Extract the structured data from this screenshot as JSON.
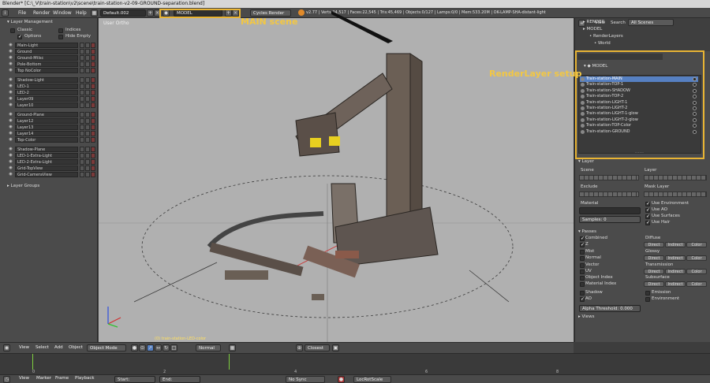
{
  "window": {
    "title": "Blender* [C:\\_V\\train-station\\v2\\scene\\train-station-v2-09-GROUND-separation.blend]"
  },
  "menubar": {
    "file": "File",
    "render": "Render",
    "window": "Window",
    "help": "Help",
    "screen_layout": "Default.002",
    "scene_name": "MODEL",
    "render_engine": "Cycles Render",
    "stats": "v2.77 | Verts:24,517 | Faces:22,545 | Tris:45,469 | Objects:0/127 | Lamps:0/0 | Mem:533.20M | OK-LAMP-SHA-distant-light"
  },
  "annotations": {
    "main_scene": "MAIN scene",
    "renderlayer_setup": "RenderLayer setup"
  },
  "left_panel": {
    "section_layer_management": "Layer Management",
    "classic": "Classic",
    "indices": "Indices",
    "options": "Options",
    "hide_empty": "Hide Empty",
    "layers_group1": [
      "Main-Light",
      "Ground",
      "Ground-Mtlsc",
      "Pole-Bottom",
      "Top NoColor"
    ],
    "layers_group2": [
      "Shadow-Light",
      "LED-1",
      "LED-2",
      "Layer09",
      "Layer10"
    ],
    "layers_group3": [
      "Ground-Plane",
      "Layer12",
      "Layer13",
      "Layer14",
      "Top-Color"
    ],
    "layers_group4": [
      "Shadow-Plane",
      "LED-1-Extra-Light",
      "LED-2-Extra-Light",
      "Grid-TopView",
      "Grid-CameraView"
    ],
    "section_layer_groups": "Layer Groups"
  },
  "viewport": {
    "label": "User Ortho",
    "bottom_label": "(0) train-station-LED-color"
  },
  "outliner": {
    "view": "View",
    "search": "Search",
    "all_scenes": "All Scenes",
    "items": [
      "RENDER",
      "MODEL",
      "RenderLayers",
      "World"
    ]
  },
  "properties": {
    "context": "MODEL",
    "renderlayers": [
      "Train-station-MAIN",
      "Train-station-TOP-1",
      "Train-station-SHADOW",
      "Train-station-TOP-2",
      "Train-station-LIGHT-1",
      "Train-station-LIGHT-2",
      "Train-station-LIGHT-1-glow",
      "Train-station-LIGHT-2-glow",
      "Train-station-TOP-Color",
      "Train-station-GROUND"
    ],
    "layer_section": "Layer",
    "scene": "Scene",
    "layer": "Layer",
    "exclude": "Exclude",
    "mask_layer": "Mask Layer",
    "material": "Material",
    "samples": "Samples:",
    "samples_value": "0",
    "use_environment": "Use Environment",
    "use_ao": "Use AO",
    "use_surfaces": "Use Surfaces",
    "use_hair": "Use Hair",
    "passes_section": "Passes",
    "combined": "Combined",
    "z": "Z",
    "mist": "Mist",
    "normal": "Normal",
    "vector": "Vector",
    "uv": "UV",
    "object_index": "Object Index",
    "material_index": "Material Index",
    "shadow": "Shadow",
    "ao": "AO",
    "diffuse": "Diffuse",
    "glossy": "Glossy",
    "transmission": "Transmission",
    "subsurface": "Subsurface",
    "emission": "Emission",
    "environment": "Environment",
    "direct": "Direct",
    "indirect": "Indirect",
    "color": "Color",
    "alpha_threshold": "Alpha Threshold:",
    "alpha_threshold_value": "0.000",
    "views_section": "Views"
  },
  "view_header": {
    "view": "View",
    "select": "Select",
    "add": "Add",
    "object": "Object",
    "mode": "Object Mode",
    "pivot": "Normal",
    "snap": "Closest"
  },
  "timeline_header": {
    "view": "View",
    "marker": "Marker",
    "frame": "Frame",
    "playback": "Playback",
    "start": "Start:",
    "end": "End:",
    "sync": "No Sync",
    "keying": "LocRotScale"
  },
  "timeline_ticks": [
    "0",
    "2",
    "4",
    "6",
    "8"
  ]
}
